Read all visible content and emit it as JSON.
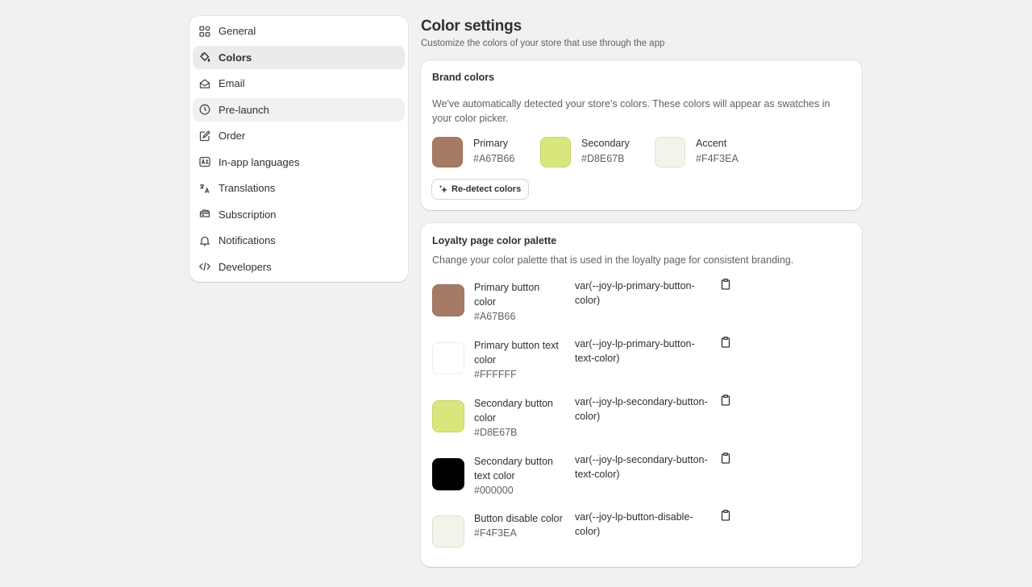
{
  "sidebar": {
    "items": [
      {
        "label": "General",
        "icon": "general-icon"
      },
      {
        "label": "Colors",
        "icon": "paint-bucket-icon",
        "active": true
      },
      {
        "label": "Email",
        "icon": "email-icon"
      },
      {
        "label": "Pre-launch",
        "icon": "clock-icon"
      },
      {
        "label": "Order",
        "icon": "order-icon"
      },
      {
        "label": "In-app languages",
        "icon": "language-icon"
      },
      {
        "label": "Translations",
        "icon": "translate-icon"
      },
      {
        "label": "Subscription",
        "icon": "credit-card-icon"
      },
      {
        "label": "Notifications",
        "icon": "bell-icon"
      },
      {
        "label": "Developers",
        "icon": "code-icon"
      }
    ]
  },
  "page": {
    "title": "Color settings",
    "subtitle": "Customize the colors of your store that use through the app"
  },
  "brand": {
    "title": "Brand colors",
    "description": "We've automatically detected your store's colors. These colors will appear as swatches in your color picker.",
    "colors": [
      {
        "label": "Primary",
        "hex": "#A67B66"
      },
      {
        "label": "Secondary",
        "hex": "#D8E67B"
      },
      {
        "label": "Accent",
        "hex": "#F4F3EA"
      }
    ],
    "redetect_label": "Re-detect colors"
  },
  "palette": {
    "title": "Loyalty page color palette",
    "description": "Change your color palette that is used in the loyalty page for consistent branding.",
    "rows": [
      {
        "label": "Primary button color",
        "hex": "#A67B66",
        "var": "var(--joy-lp-primary-button-color)"
      },
      {
        "label": "Primary button text color",
        "hex": "#FFFFFF",
        "var": "var(--joy-lp-primary-button-text-color)"
      },
      {
        "label": "Secondary button color",
        "hex": "#D8E67B",
        "var": "var(--joy-lp-secondary-button-color)"
      },
      {
        "label": "Secondary button text color",
        "hex": "#000000",
        "var": "var(--joy-lp-secondary-button-text-color)"
      },
      {
        "label": "Button disable color",
        "hex": "#F4F3EA",
        "var": "var(--joy-lp-button-disable-color)"
      }
    ]
  }
}
